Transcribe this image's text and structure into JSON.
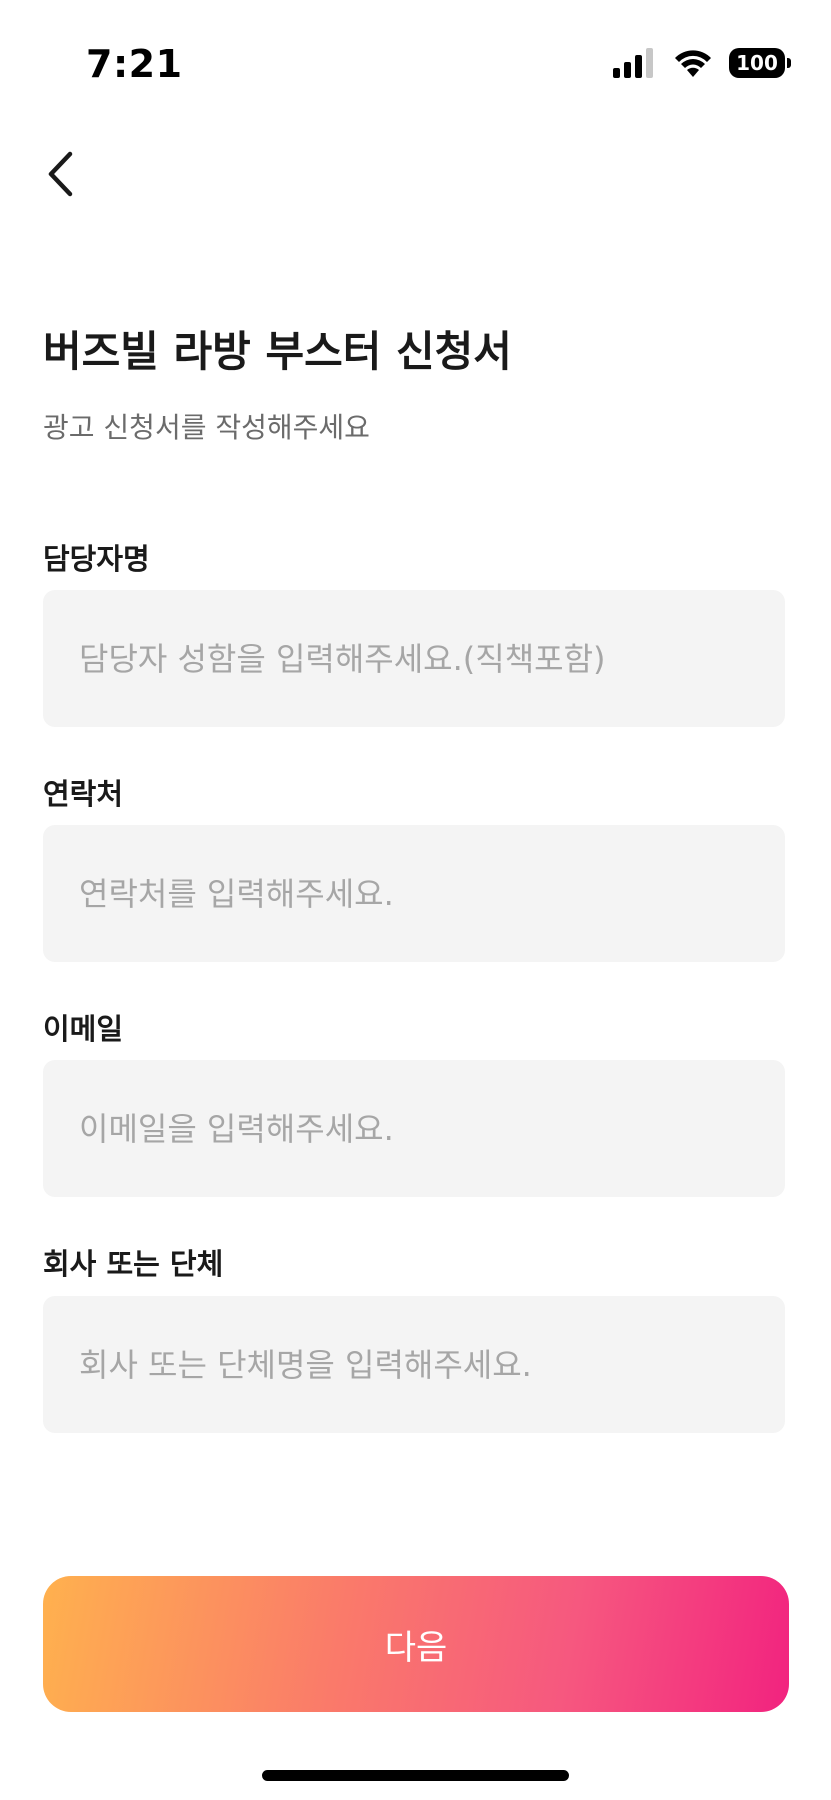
{
  "status_bar": {
    "time": "7:21",
    "battery": "100",
    "icons": [
      "signal-icon",
      "wifi-icon",
      "battery-icon"
    ]
  },
  "nav": {
    "back_icon": "chevron-left-icon"
  },
  "header": {
    "title": "버즈빌 라방 부스터 신청서",
    "subtitle": "광고 신청서를 작성해주세요"
  },
  "form": {
    "fields": [
      {
        "label": "담당자명",
        "value": "",
        "placeholder": "담당자 성함을 입력해주세요.(직책포함)"
      },
      {
        "label": "연락처",
        "value": "",
        "placeholder": "연락처를 입력해주세요."
      },
      {
        "label": "이메일",
        "value": "",
        "placeholder": "이메일을 입력해주세요."
      },
      {
        "label": "회사 또는 단체",
        "value": "",
        "placeholder": "회사 또는 단체명을 입력해주세요."
      }
    ]
  },
  "actions": {
    "next_label": "다음"
  },
  "colors": {
    "background": "#ffffff",
    "input_background": "#f4f4f4",
    "placeholder": "#a6a6a6",
    "subtitle": "#6b6b6b",
    "gradient_start": "#ffb14e",
    "gradient_end": "#f2237f"
  }
}
